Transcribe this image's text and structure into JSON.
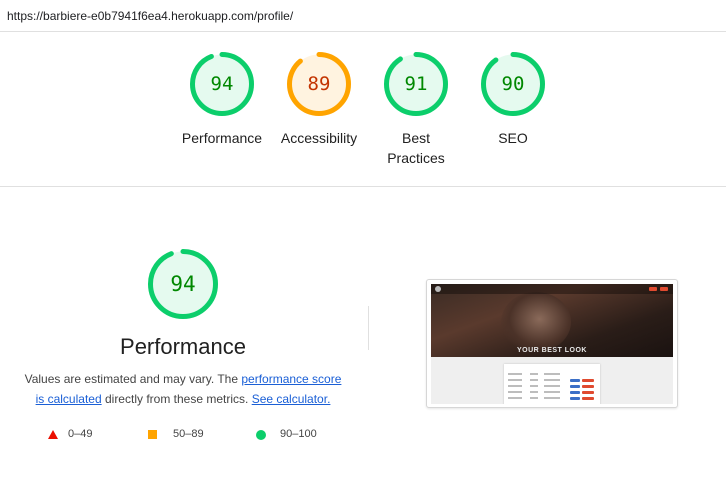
{
  "browser": {
    "url": "https://barbiere-e0b7941f6ea4.herokuapp.com/profile/"
  },
  "gauges": [
    {
      "score": "94",
      "label": "Performance",
      "status": "pass",
      "value": 0.94
    },
    {
      "score": "89",
      "label": "Accessibility",
      "status": "average",
      "value": 0.89
    },
    {
      "score": "91",
      "label": "Best Practices",
      "status": "pass",
      "value": 0.91
    },
    {
      "score": "90",
      "label": "SEO",
      "status": "pass",
      "value": 0.9
    }
  ],
  "detail": {
    "score": "94",
    "value": 0.94,
    "title": "Performance",
    "desc_prefix": "Values are estimated and may vary. The ",
    "link_score": "performance score is calculated",
    "desc_middle": " directly from these metrics. ",
    "link_calc": "See calculator."
  },
  "legend": {
    "fail": "0–49",
    "average": "50–89",
    "pass": "90–100"
  },
  "screenshot": {
    "hero_text": "YOUR BEST LOOK"
  },
  "colors": {
    "pass_ring": "#0cce6b",
    "pass_bg": "#e5faef",
    "pass_text": "#008800",
    "average_ring": "#ffa400",
    "average_bg": "#fff3e0",
    "average_text": "#c33300",
    "fail": "#eb0f00"
  }
}
